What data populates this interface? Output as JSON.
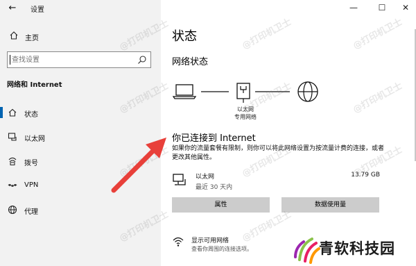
{
  "window": {
    "title": "设置",
    "controls": {
      "minimize": "—",
      "maximize": "☐",
      "close": "✕"
    }
  },
  "sidebar": {
    "home_label": "主页",
    "search_placeholder": "查找设置",
    "section_label": "网络和 Internet",
    "items": [
      {
        "label": "状态",
        "icon": "home-signal-icon",
        "selected": true
      },
      {
        "label": "以太网",
        "icon": "ethernet-icon",
        "selected": false
      },
      {
        "label": "拨号",
        "icon": "dialup-icon",
        "selected": false
      },
      {
        "label": "VPN",
        "icon": "vpn-icon",
        "selected": false
      },
      {
        "label": "代理",
        "icon": "globe-icon",
        "selected": false
      }
    ]
  },
  "main": {
    "page_title": "状态",
    "network_status_title": "网络状态",
    "diagram": {
      "label_line1": "以太网",
      "label_line2": "专用网络"
    },
    "connected_title": "你已连接到 Internet",
    "connected_desc": "如果你的流量套餐有限制，则你可以将此网络设置为按流量计费的连接，或者更改其他属性。",
    "network": {
      "name": "以太网",
      "subtitle": "最近 30 天内",
      "usage": "13.79 GB"
    },
    "buttons": {
      "properties": "属性",
      "data_usage": "数据使用量"
    },
    "available": {
      "title": "显示可用网络",
      "subtitle": "查看你周围的连接选项。"
    }
  },
  "watermark_text": "@打印机卫士",
  "logo_text": "青软科技园",
  "colors": {
    "accent": "#0063b1",
    "sidebar_bg": "#f2f2f2",
    "button_bg": "#cccccc",
    "arrow": "#e8403a"
  }
}
